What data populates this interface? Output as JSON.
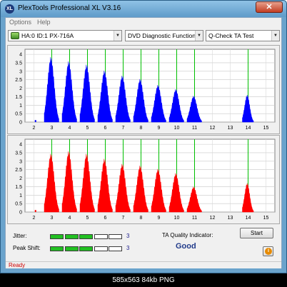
{
  "window": {
    "title": "PlexTools Professional XL V3.16",
    "app_icon": "XL",
    "close_glyph": "✕"
  },
  "menu": {
    "items": [
      "Options",
      "Help"
    ]
  },
  "toolbar": {
    "drive": "HA:0 ID:1  PX-716A",
    "function": "DVD Diagnostic Functions",
    "test": "Q-Check TA Test"
  },
  "colors": {
    "top_series": "#0000ff",
    "bottom_series": "#ff0000",
    "marker": "#00c000",
    "plot_bg": "#ffffff"
  },
  "chart_data": [
    {
      "type": "area",
      "series": [
        {
          "values": "blue jitter peaks"
        }
      ],
      "xlim": [
        1.5,
        15.5
      ],
      "ylim": [
        0,
        4.3
      ],
      "xticks": [
        "2",
        "3",
        "4",
        "5",
        "6",
        "7",
        "8",
        "9",
        "10",
        "11",
        "12",
        "13",
        "14",
        "15"
      ],
      "yticks": [
        "0",
        "0.5",
        "1",
        "1.5",
        "2",
        "2.5",
        "3",
        "3.5",
        "4"
      ],
      "markers_x": [
        3,
        4,
        5,
        6,
        7,
        8,
        9,
        10,
        11,
        14
      ],
      "peaks": [
        {
          "x": 3,
          "y": 3.85
        },
        {
          "x": 4,
          "y": 3.6
        },
        {
          "x": 5,
          "y": 3.4
        },
        {
          "x": 6,
          "y": 3.05
        },
        {
          "x": 7,
          "y": 2.75
        },
        {
          "x": 8,
          "y": 2.55
        },
        {
          "x": 9,
          "y": 2.2
        },
        {
          "x": 10,
          "y": 1.95
        },
        {
          "x": 11,
          "y": 1.55
        },
        {
          "x": 14,
          "y": 1.6
        }
      ],
      "grid": true
    },
    {
      "type": "area",
      "series": [
        {
          "values": "red peak shift peaks"
        }
      ],
      "xlim": [
        1.5,
        15.5
      ],
      "ylim": [
        0,
        4.3
      ],
      "xticks": [
        "2",
        "3",
        "4",
        "5",
        "6",
        "7",
        "8",
        "9",
        "10",
        "11",
        "12",
        "13",
        "14",
        "15"
      ],
      "yticks": [
        "0",
        "0.5",
        "1",
        "1.5",
        "2",
        "2.5",
        "3",
        "3.5",
        "4"
      ],
      "markers_x": [
        3,
        4,
        5,
        6,
        7,
        8,
        9,
        10,
        11,
        14
      ],
      "peaks": [
        {
          "x": 3,
          "y": 3.45
        },
        {
          "x": 4,
          "y": 3.6
        },
        {
          "x": 5,
          "y": 3.45
        },
        {
          "x": 6,
          "y": 3.15
        },
        {
          "x": 7,
          "y": 2.85
        },
        {
          "x": 8,
          "y": 2.75
        },
        {
          "x": 9,
          "y": 2.55
        },
        {
          "x": 10,
          "y": 2.3
        },
        {
          "x": 11,
          "y": 1.5
        },
        {
          "x": 14,
          "y": 1.7
        }
      ],
      "grid": true
    }
  ],
  "meters": {
    "jitter": {
      "label": "Jitter:",
      "value": "3",
      "filled": 3,
      "total": 5
    },
    "peak_shift": {
      "label": "Peak Shift:",
      "value": "3",
      "filled": 3,
      "total": 5
    }
  },
  "ta": {
    "label": "TA Quality Indicator:",
    "value": "Good"
  },
  "buttons": {
    "start": "Start",
    "info_icon": "info-icon"
  },
  "status": {
    "text": "Ready"
  },
  "caption": "585x563 84kb PNG"
}
